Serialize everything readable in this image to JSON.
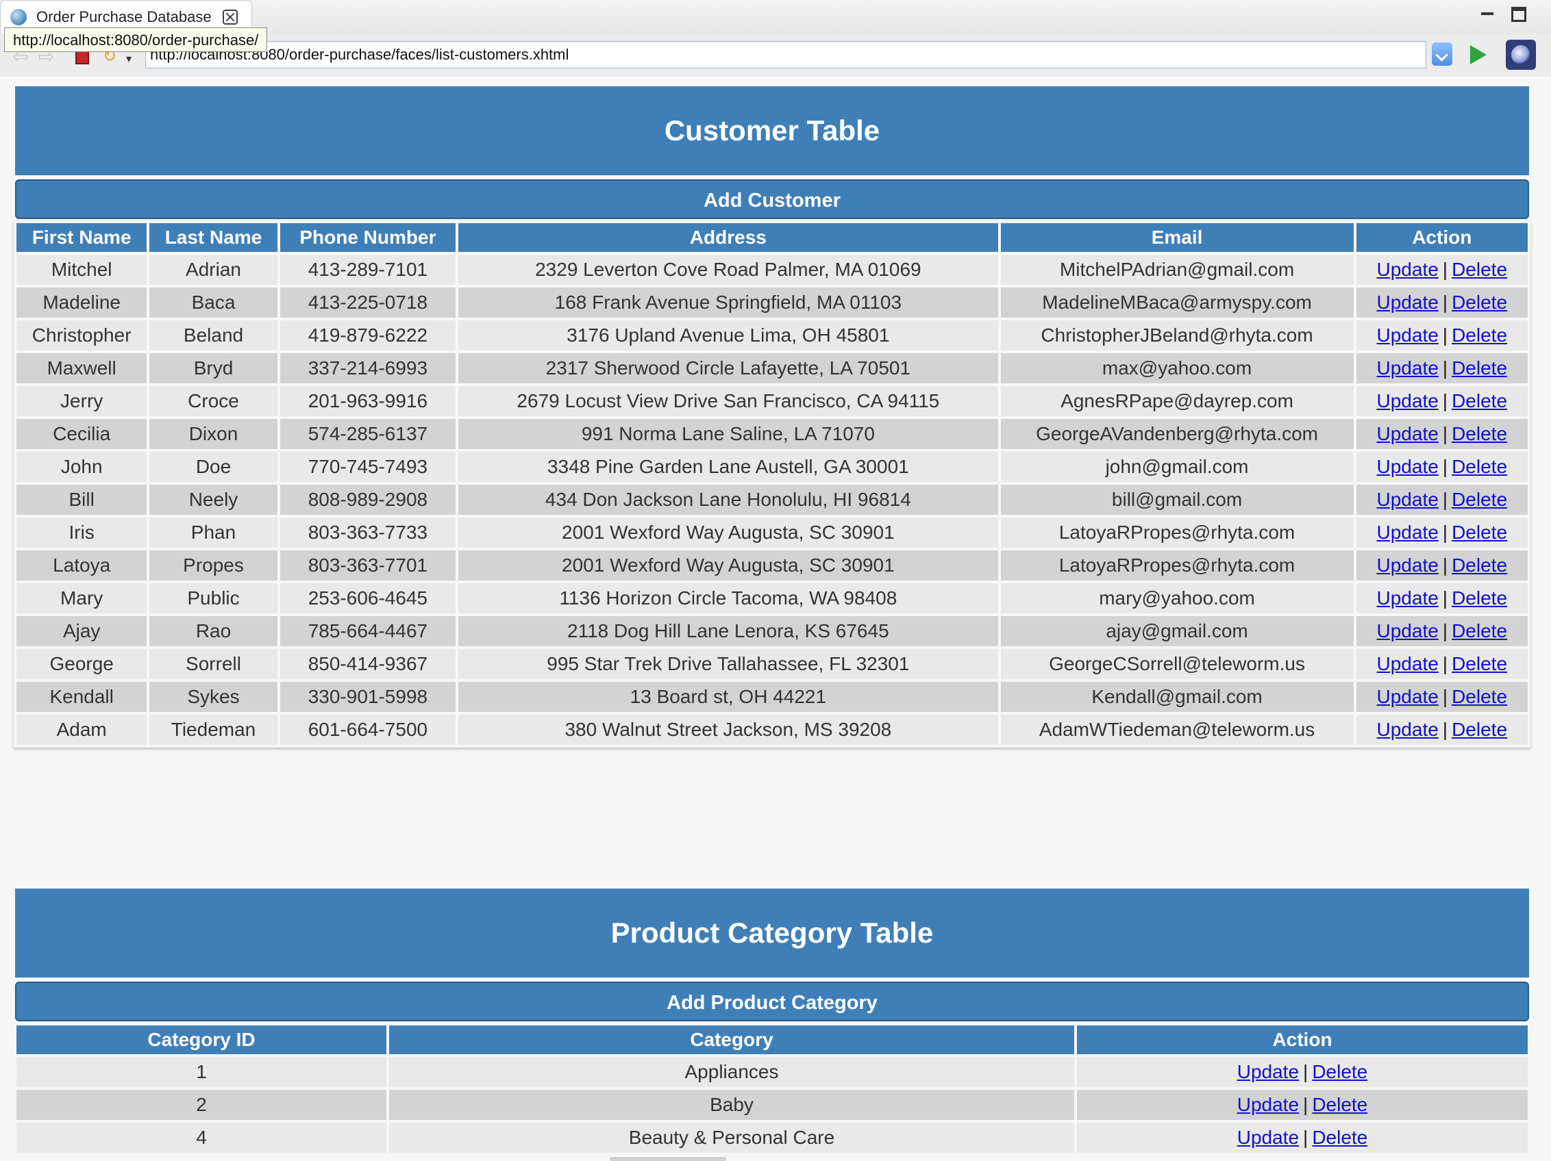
{
  "browser": {
    "tab_title": "Order Purchase Database",
    "tooltip": "http://localhost:8080/order-purchase/",
    "address": "http://localhost:8080/order-purchase/faces/list-customers.xhtml"
  },
  "customer_section": {
    "title": "Customer Table",
    "add_label": "Add Customer",
    "columns": [
      "First Name",
      "Last Name",
      "Phone Number",
      "Address",
      "Email",
      "Action"
    ],
    "update_label": "Update",
    "delete_label": "Delete",
    "rows": [
      [
        "Mitchel",
        "Adrian",
        "413-289-7101",
        "2329 Leverton Cove Road Palmer, MA 01069",
        "MitchelPAdrian@gmail.com"
      ],
      [
        "Madeline",
        "Baca",
        "413-225-0718",
        "168 Frank Avenue Springfield, MA 01103",
        "MadelineMBaca@armyspy.com"
      ],
      [
        "Christopher",
        "Beland",
        "419-879-6222",
        "3176 Upland Avenue Lima, OH 45801",
        "ChristopherJBeland@rhyta.com"
      ],
      [
        "Maxwell",
        "Bryd",
        "337-214-6993",
        "2317 Sherwood Circle Lafayette, LA 70501",
        "max@yahoo.com"
      ],
      [
        "Jerry",
        "Croce",
        "201-963-9916",
        "2679 Locust View Drive San Francisco, CA 94115",
        "AgnesRPape@dayrep.com"
      ],
      [
        "Cecilia",
        "Dixon",
        "574-285-6137",
        "991 Norma Lane Saline, LA 71070",
        "GeorgeAVandenberg@rhyta.com"
      ],
      [
        "John",
        "Doe",
        "770-745-7493",
        "3348 Pine Garden Lane Austell, GA 30001",
        "john@gmail.com"
      ],
      [
        "Bill",
        "Neely",
        "808-989-2908",
        "434 Don Jackson Lane Honolulu, HI 96814",
        "bill@gmail.com"
      ],
      [
        "Iris",
        "Phan",
        "803-363-7733",
        "2001 Wexford Way Augusta, SC 30901",
        "LatoyaRPropes@rhyta.com"
      ],
      [
        "Latoya",
        "Propes",
        "803-363-7701",
        "2001 Wexford Way Augusta, SC 30901",
        "LatoyaRPropes@rhyta.com"
      ],
      [
        "Mary",
        "Public",
        "253-606-4645",
        "1136 Horizon Circle Tacoma, WA 98408",
        "mary@yahoo.com"
      ],
      [
        "Ajay",
        "Rao",
        "785-664-4467",
        "2118 Dog Hill Lane Lenora, KS 67645",
        "ajay@gmail.com"
      ],
      [
        "George",
        "Sorrell",
        "850-414-9367",
        "995 Star Trek Drive Tallahassee, FL 32301",
        "GeorgeCSorrell@teleworm.us"
      ],
      [
        "Kendall",
        "Sykes",
        "330-901-5998",
        "13 Board st, OH 44221",
        "Kendall@gmail.com"
      ],
      [
        "Adam",
        "Tiedeman",
        "601-664-7500",
        "380 Walnut Street Jackson, MS 39208",
        "AdamWTiedeman@teleworm.us"
      ]
    ]
  },
  "category_section": {
    "title": "Product Category Table",
    "add_label": "Add Product Category",
    "columns": [
      "Category ID",
      "Category",
      "Action"
    ],
    "update_label": "Update",
    "delete_label": "Delete",
    "rows": [
      [
        "1",
        "Appliances"
      ],
      [
        "2",
        "Baby"
      ],
      [
        "4",
        "Beauty & Personal Care"
      ]
    ]
  }
}
